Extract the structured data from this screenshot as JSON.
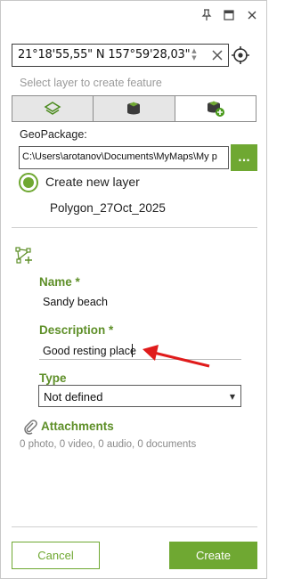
{
  "window": {
    "pin_icon": "pin-icon",
    "maximize_icon": "maximize-icon",
    "close_icon": "close-icon"
  },
  "coordinates": {
    "value": "21°18'55,55\" N 157°59'28,03\"",
    "clear_icon": "clear-x-icon",
    "locate_icon": "crosshair-icon"
  },
  "layer_select": {
    "hint": "Select layer to create feature",
    "options": [
      {
        "icon": "layers-icon",
        "selected": false
      },
      {
        "icon": "database-layer-icon",
        "selected": false
      },
      {
        "icon": "database-add-icon",
        "selected": true
      }
    ]
  },
  "geopackage": {
    "label": "GeoPackage:",
    "path": "C:\\Users\\arotanov\\Documents\\MyMaps\\My p",
    "browse_label": "...",
    "create_new_layer_label": "Create new layer",
    "layer_name": "Polygon_27Oct_2025"
  },
  "feature": {
    "icon": "polygon-add-icon",
    "name_label": "Name *",
    "name_value": "Sandy beach",
    "description_label": "Description *",
    "description_value": "Good resting place",
    "type_label": "Type",
    "type_value": "Not defined",
    "attachments_label": "Attachments",
    "attachments_summary": "0 photo, 0 video, 0 audio, 0 documents"
  },
  "buttons": {
    "cancel": "Cancel",
    "create": "Create"
  },
  "colors": {
    "accent": "#6fa832",
    "label_green": "#5e8f28",
    "annotation_arrow": "#e01b1b"
  }
}
